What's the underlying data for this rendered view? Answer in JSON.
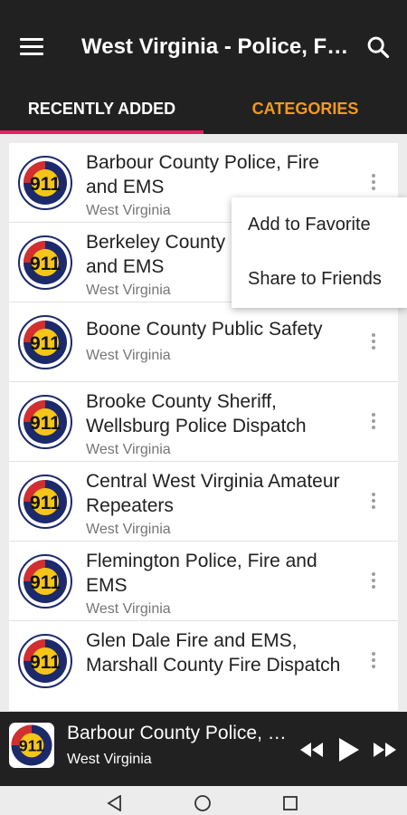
{
  "app_bar": {
    "title": "West Virginia - Police, Fire and EMS"
  },
  "tabs": [
    {
      "label": "RECENTLY ADDED",
      "active": true
    },
    {
      "label": "CATEGORIES",
      "active": false
    }
  ],
  "logo_text": "911",
  "stations": [
    {
      "title": "Barbour County Police, Fire and EMS",
      "subtitle": "West Virginia"
    },
    {
      "title": "Berkeley County Police, Fire and EMS",
      "subtitle": "West Virginia"
    },
    {
      "title": "Boone County Public Safety",
      "subtitle": "West Virginia"
    },
    {
      "title": "Brooke County Sheriff, Wellsburg Police Dispatch",
      "subtitle": "West Virginia"
    },
    {
      "title": "Central West Virginia Amateur Repeaters",
      "subtitle": "West Virginia"
    },
    {
      "title": "Flemington Police, Fire and EMS",
      "subtitle": "West Virginia"
    },
    {
      "title": "Glen Dale Fire and EMS, Marshall County Fire Dispatch",
      "subtitle": "West Virginia"
    }
  ],
  "popup_menu": {
    "items": [
      "Add to Favorite",
      "Share to Friends"
    ]
  },
  "player": {
    "title": "Barbour County Police, Fire and EMS",
    "subtitle": "West Virginia"
  },
  "colors": {
    "toolbar": "#212121",
    "tab_accent": "#e91e63",
    "tab_inactive_text": "#f39a1e"
  }
}
